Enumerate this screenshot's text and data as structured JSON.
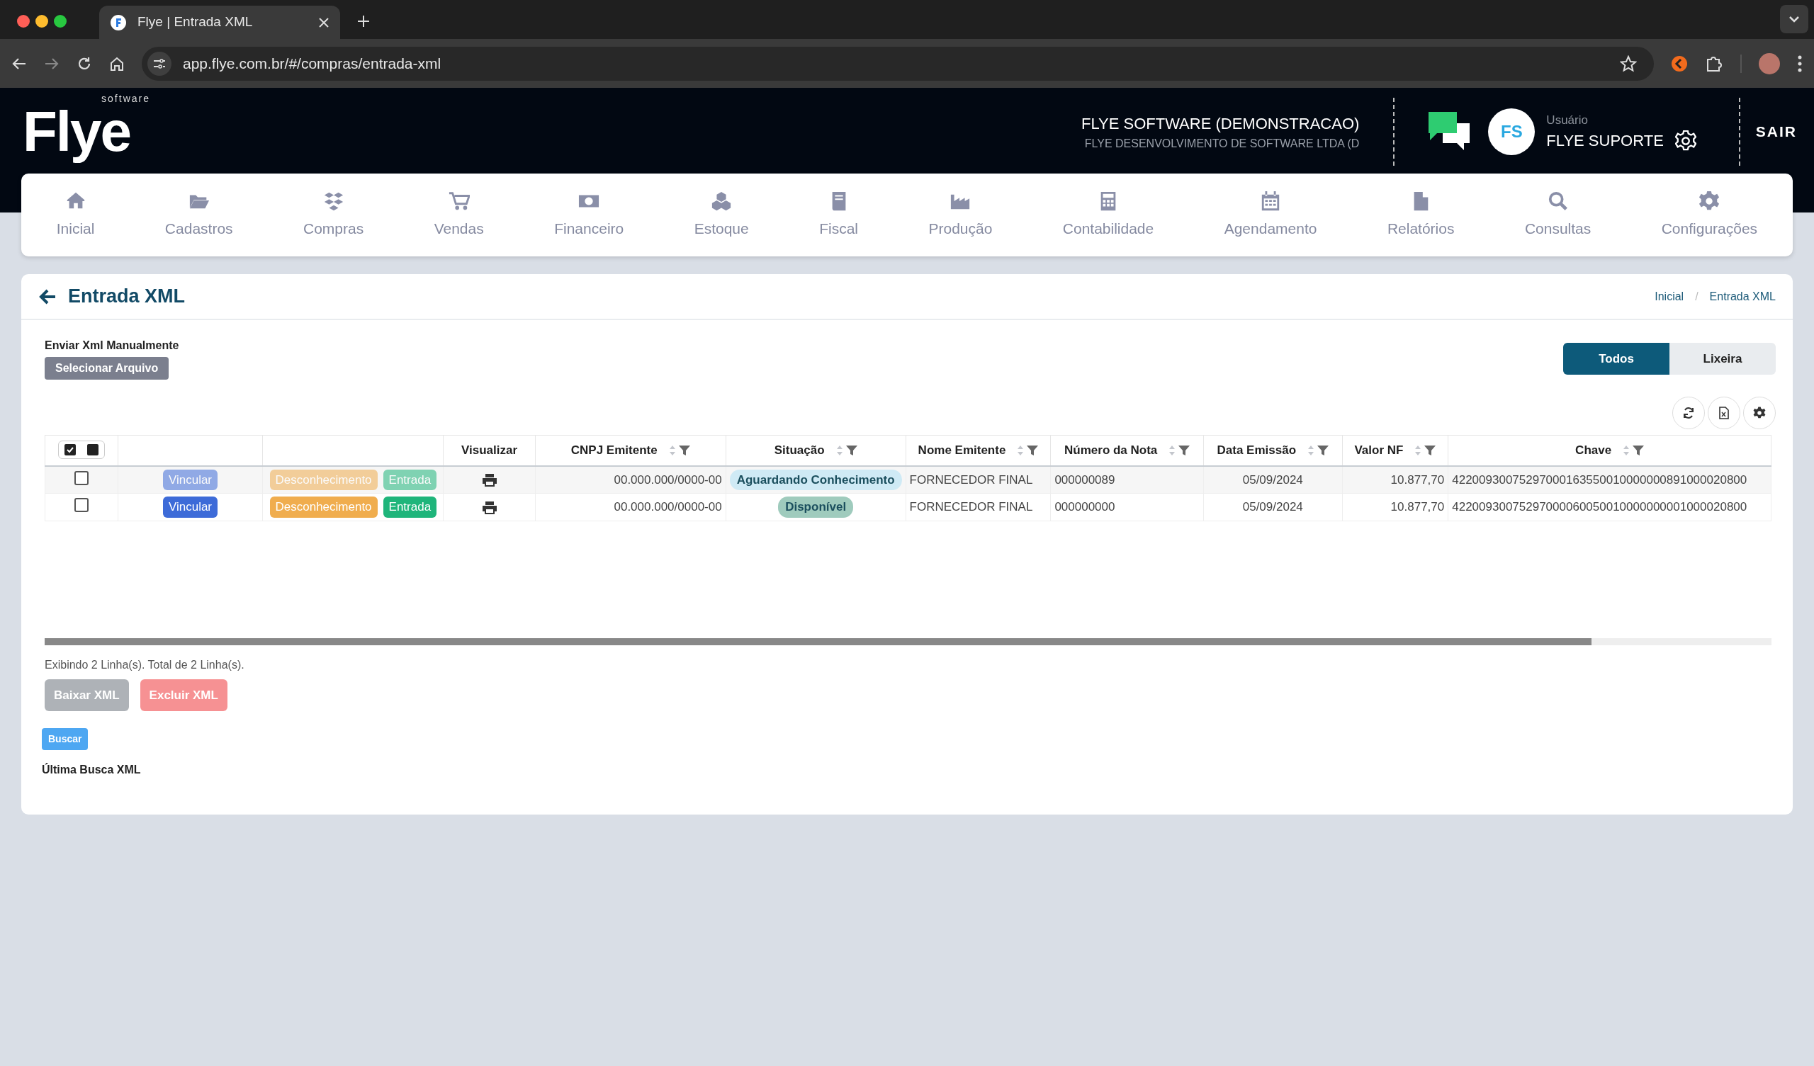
{
  "browser": {
    "tab_title": "Flye | Entrada XML",
    "url": "app.flye.com.br/#/compras/entrada-xml"
  },
  "header": {
    "logo_text": "Flye",
    "logo_sub": "software",
    "company": "FLYE SOFTWARE (DEMONSTRACAO)",
    "company_sub": "FLYE DESENVOLVIMENTO DE SOFTWARE LTDA (D",
    "avatar_initials": "FS",
    "user_label": "Usuário",
    "user_name": "FLYE SUPORTE",
    "logout": "SAIR"
  },
  "nav": [
    {
      "label": "Inicial"
    },
    {
      "label": "Cadastros"
    },
    {
      "label": "Compras"
    },
    {
      "label": "Vendas"
    },
    {
      "label": "Financeiro"
    },
    {
      "label": "Estoque"
    },
    {
      "label": "Fiscal"
    },
    {
      "label": "Produção"
    },
    {
      "label": "Contabilidade"
    },
    {
      "label": "Agendamento"
    },
    {
      "label": "Relatórios"
    },
    {
      "label": "Consultas"
    },
    {
      "label": "Configurações"
    }
  ],
  "page": {
    "title": "Entrada XML",
    "breadcrumb": [
      {
        "label": "Inicial"
      },
      {
        "label": "Entrada XML"
      }
    ],
    "breadcrumb_separator": "/",
    "upload_label": "Enviar Xml Manualmente",
    "upload_button": "Selecionar Arquivo",
    "filter_tabs": [
      {
        "label": "Todos",
        "selected": true
      },
      {
        "label": "Lixeira",
        "selected": false
      }
    ]
  },
  "table": {
    "columns": [
      {
        "label": "Visualizar"
      },
      {
        "label": "CNPJ Emitente",
        "sortable": true,
        "filterable": true
      },
      {
        "label": "Situação",
        "sortable": true,
        "filterable": true
      },
      {
        "label": "Nome Emitente",
        "sortable": true,
        "filterable": true
      },
      {
        "label": "Número da Nota",
        "sortable": true,
        "filterable": true
      },
      {
        "label": "Data Emissão",
        "sortable": true,
        "filterable": true
      },
      {
        "label": "Valor NF",
        "sortable": true,
        "filterable": true
      },
      {
        "label": "Chave",
        "sortable": true,
        "filterable": true
      }
    ],
    "rows": [
      {
        "checked": false,
        "disabled": true,
        "vincular": "Vincular",
        "desconhecimento": "Desconhecimento",
        "entrada": "Entrada",
        "cnpj": "00.000.000/0000-00",
        "situacao": {
          "text": "Aguardando Conhecimento",
          "color": "#cfeaf5"
        },
        "nome": "FORNECEDOR FINAL",
        "numero": "000000089",
        "data": "05/09/2024",
        "valor": "10.877,70",
        "chave": "42200930075297000163550010000000891000020800"
      },
      {
        "checked": false,
        "disabled": false,
        "vincular": "Vincular",
        "desconhecimento": "Desconhecimento",
        "entrada": "Entrada",
        "cnpj": "00.000.000/0000-00",
        "situacao": {
          "text": "Disponível",
          "color": "#9fcbbd"
        },
        "nome": "FORNECEDOR FINAL",
        "numero": "000000000",
        "data": "05/09/2024",
        "valor": "10.877,70",
        "chave": "42200930075297000060050010000000001000020800"
      }
    ]
  },
  "footer": {
    "summary": "Exibindo 2 Linha(s). Total de 2 Linha(s).",
    "buttons": [
      {
        "label": "Baixar XML",
        "kind": "secondary",
        "disabled": true
      },
      {
        "label": "Excluir XML",
        "kind": "danger",
        "disabled": true
      }
    ],
    "search_button": "Buscar",
    "last_search": "Última Busca XML"
  }
}
